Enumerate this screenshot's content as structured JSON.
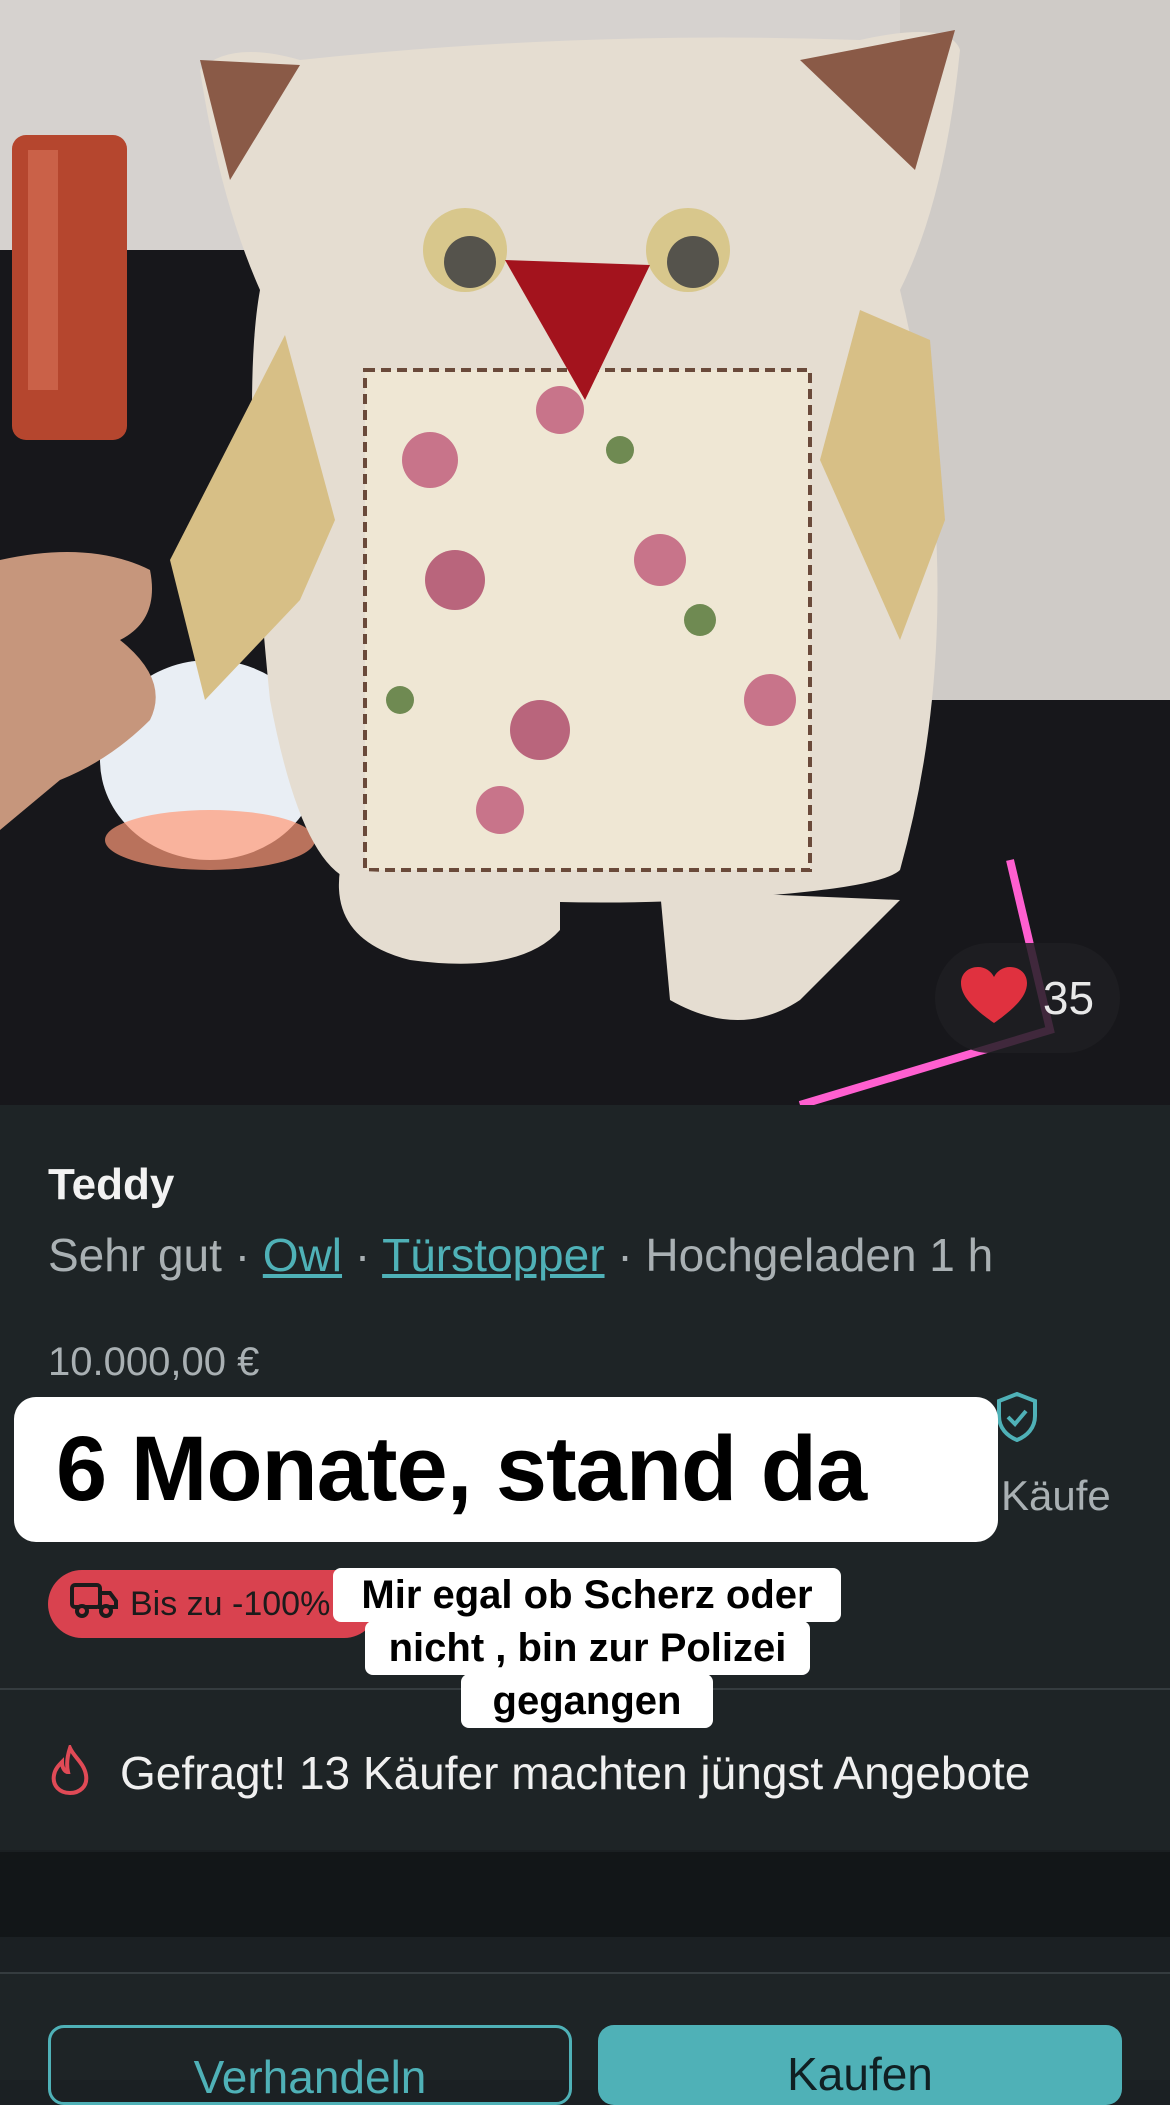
{
  "photo": {
    "alt_subject": "",
    "likes": "35"
  },
  "listing": {
    "title": "Teddy",
    "condition": "Sehr gut",
    "sep": "·",
    "brand": "Owl",
    "category": "Türstopper",
    "uploaded": "Hochgeladen 1 h",
    "price": "10.000,00 €",
    "protection_suffix": "Käufe",
    "shipping_badge": "Bis zu -100%"
  },
  "demand": {
    "text": "Gefragt! 13 Käufer machten jüngst Angebote"
  },
  "buttons": {
    "offer": "Verhandeln",
    "buy": "Kaufen"
  },
  "captions": {
    "main": "6 Monate, stand da",
    "sub_lines": [
      "Mir egal ob Scherz oder",
      "nicht , bin zur Polizei",
      "gegangen"
    ]
  },
  "colors": {
    "accent": "#4fb1b7",
    "badge": "#d9424f",
    "heart": "#e0313f"
  }
}
